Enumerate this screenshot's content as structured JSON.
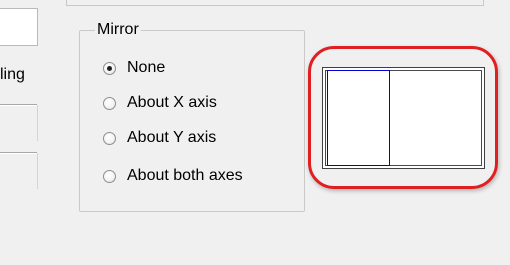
{
  "left_panel": {
    "clipped_label": "ling"
  },
  "mirror": {
    "title": "Mirror",
    "options": [
      {
        "label": "None",
        "checked": true
      },
      {
        "label": "About X axis",
        "checked": false
      },
      {
        "label": "About Y axis",
        "checked": false
      },
      {
        "label": "About both axes",
        "checked": false
      }
    ]
  },
  "preview": {
    "highlight_color": "#e02020",
    "rect_color": "#0000d0"
  }
}
